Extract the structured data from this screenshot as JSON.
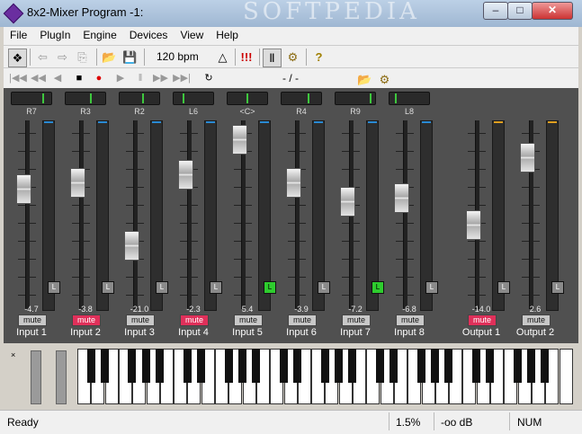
{
  "window": {
    "title": "8x2-Mixer Program -1:",
    "watermark": "SOFTPEDIA",
    "min_label": "–",
    "max_label": "□",
    "close_label": "✕"
  },
  "menu": [
    "File",
    "PlugIn",
    "Engine",
    "Devices",
    "View",
    "Help"
  ],
  "toolbar": {
    "bpm": "120 bpm",
    "icons": [
      "midi-keyboard-icon",
      "back-arrow-icon",
      "forward-arrow-icon",
      "copy-icon",
      "open-folder-icon",
      "save-icon",
      "metronome-icon",
      "panic-icon",
      "piano-view-icon",
      "settings-icon",
      "help-icon"
    ],
    "glyphs": [
      "❖",
      "⇦",
      "⇨",
      "⎘",
      "📂",
      "💾",
      "△",
      "!!!",
      "Ⅱ",
      "⚙",
      "?"
    ]
  },
  "transport": {
    "position": "- / -",
    "glyphs": [
      "|◀◀",
      "◀◀",
      "◀",
      "■",
      "●",
      "▶",
      "‖",
      "▶▶",
      "▶▶|",
      "↻"
    ]
  },
  "channels": [
    {
      "name": "Input 1",
      "pan": "R7",
      "pan_pos": 0.85,
      "value": "-4.7",
      "level": 0.66,
      "mute": false,
      "lit": false
    },
    {
      "name": "Input 2",
      "pan": "R3",
      "pan_pos": 0.65,
      "value": "-3.8",
      "level": 0.7,
      "mute": true,
      "lit": false
    },
    {
      "name": "Input 3",
      "pan": "R2",
      "pan_pos": 0.6,
      "value": "-21.0",
      "level": 0.3,
      "mute": false,
      "lit": false
    },
    {
      "name": "Input 4",
      "pan": "L6",
      "pan_pos": 0.2,
      "value": "-2.3",
      "level": 0.75,
      "mute": true,
      "lit": false
    },
    {
      "name": "Input 5",
      "pan": "<C>",
      "pan_pos": 0.5,
      "value": "5.4",
      "level": 0.97,
      "mute": false,
      "lit": true
    },
    {
      "name": "Input 6",
      "pan": "R4",
      "pan_pos": 0.7,
      "value": "-3.9",
      "level": 0.7,
      "mute": false,
      "lit": false
    },
    {
      "name": "Input 7",
      "pan": "R9",
      "pan_pos": 0.95,
      "value": "-7.2",
      "level": 0.58,
      "mute": false,
      "lit": true
    },
    {
      "name": "Input 8",
      "pan": "L8",
      "pan_pos": 0.1,
      "value": "-6.8",
      "level": 0.6,
      "mute": false,
      "lit": false
    },
    {
      "name": "Output 1",
      "pan": "",
      "pan_pos": null,
      "value": "-14.0",
      "level": 0.43,
      "mute": true,
      "lit": false
    },
    {
      "name": "Output 2",
      "pan": "",
      "pan_pos": null,
      "value": "2.6",
      "level": 0.86,
      "mute": false,
      "lit": false
    }
  ],
  "mute_label": "mute",
  "l_label": "L",
  "piano": {
    "close": "×",
    "white_keys": 36
  },
  "status": {
    "ready": "Ready",
    "cpu": "1.5%",
    "db": "-oo dB",
    "num": "NUM"
  },
  "colors": {
    "mixer_bg": "#505050",
    "mute_on": "#e0305a",
    "lit": "#2ecc2e",
    "meter_in": "#2a8ad4",
    "meter_out": "#e0a020"
  }
}
